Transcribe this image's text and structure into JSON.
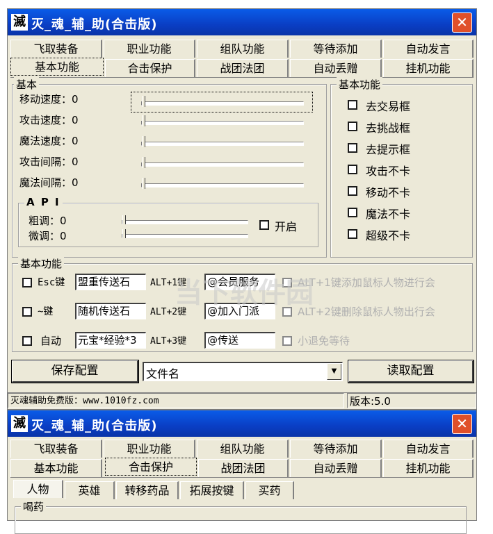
{
  "window1": {
    "app_icon": "滅",
    "title": "灭_魂_辅_助(合击版)",
    "close_glyph": "✕",
    "tabs_row1": [
      "飞取装备",
      "职业功能",
      "组队功能",
      "等待添加",
      "自动发言"
    ],
    "tabs_row2": [
      "基本功能",
      "合击保护",
      "战团法团",
      "自动丢赠",
      "挂机功能"
    ],
    "selected_tab": "基本功能",
    "basic_group": {
      "title": "基本",
      "sliders": [
        {
          "label": "移动速度：0",
          "value": 0
        },
        {
          "label": "攻击速度：0",
          "value": 0
        },
        {
          "label": "魔法速度：0",
          "value": 0
        },
        {
          "label": "攻击间隔：0",
          "value": 0
        },
        {
          "label": "魔法间隔：0",
          "value": 0
        }
      ]
    },
    "api_group": {
      "title": "A P I",
      "coarse_label": "粗调：0",
      "fine_label": "微调：0",
      "enable_label": "开启"
    },
    "right_group": {
      "title": "基本功能",
      "checkboxes": [
        "去交易框",
        "去挑战框",
        "去提示框",
        "攻击不卡",
        "移动不卡",
        "魔法不卡",
        "超级不卡"
      ]
    },
    "hotkey_group": {
      "title": "基本功能",
      "rows": [
        {
          "check_label": "Esc键",
          "edit": "盟重传送石",
          "hotkey": "ALT+1键",
          "cmd": "@会员服务",
          "option": "ALT+1键添加鼠标人物进行会"
        },
        {
          "check_label": "~键",
          "edit": "随机传送石",
          "hotkey": "ALT+2键",
          "cmd": "@加入门派",
          "option": "ALT+2键删除鼠标人物出行会"
        },
        {
          "check_label": "自动",
          "edit": "元宝*经验*3",
          "hotkey": "ALT+3键",
          "cmd": "@传送",
          "option": "小退免等待"
        }
      ]
    },
    "save_button": "保存配置",
    "file_combo": "文件名",
    "load_button": "读取配置",
    "status_left": "灭魂辅助免费版：www.1010fz.com",
    "status_right": "版本:5.0",
    "watermark": "当下软件园"
  },
  "window2": {
    "app_icon": "滅",
    "title": "灭_魂_辅_助(合击版)",
    "close_glyph": "✕",
    "tabs_row1": [
      "飞取装备",
      "职业功能",
      "组队功能",
      "等待添加",
      "自动发言"
    ],
    "tabs_row2": [
      "基本功能",
      "合击保护",
      "战团法团",
      "自动丢赠",
      "挂机功能"
    ],
    "selected_tab": "合击保护",
    "subtabs": [
      "人物",
      "英雄",
      "转移药品",
      "拓展按键",
      "买药"
    ],
    "group_title": "喝药"
  }
}
